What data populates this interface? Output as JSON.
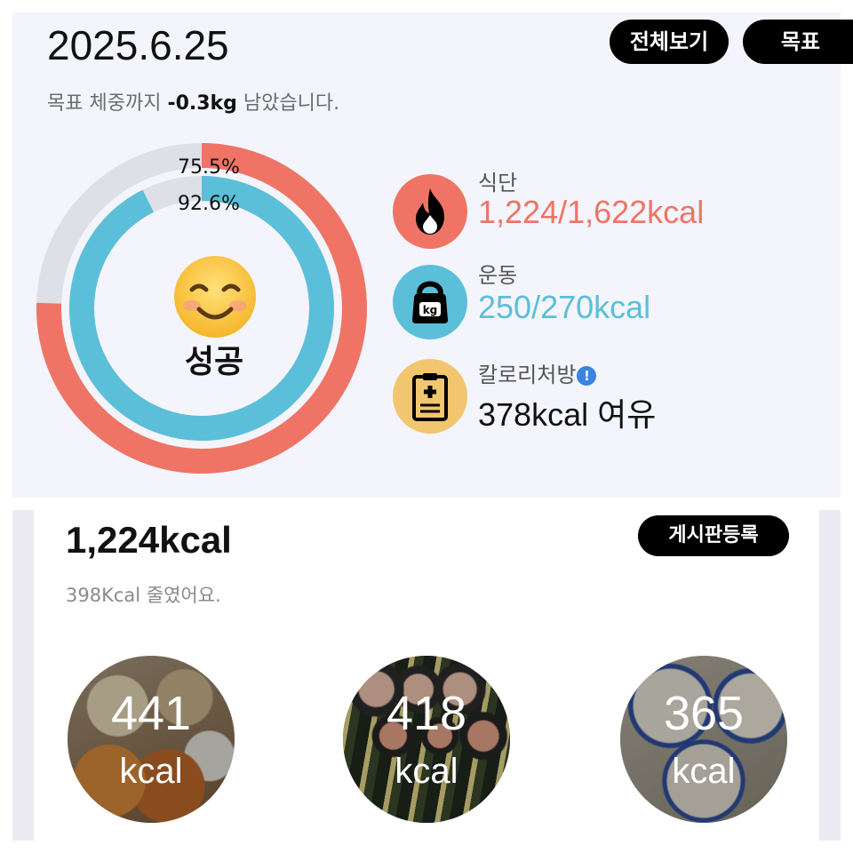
{
  "header": {
    "date": "2025.6.25",
    "view_all_label": "전체보기",
    "goal_label": "목표",
    "goal_text_before": "목표 체중까지 ",
    "goal_weight": "-0.3kg",
    "goal_text_after": " 남았습니다."
  },
  "progress": {
    "outer_percent": "75.5%",
    "inner_percent": "92.6%",
    "outer_fraction": 0.755,
    "inner_fraction": 0.926,
    "result_label": "성공",
    "emoji": "smiling-face-icon",
    "colors": {
      "outer": "#ef7465",
      "inner": "#5bbfd9",
      "track": "#dde0e6"
    }
  },
  "stats": {
    "diet": {
      "label": "식단",
      "value": "1,224/1,622kcal",
      "icon": "fire-icon",
      "color": "#ef7465"
    },
    "exercise": {
      "label": "운동",
      "value": "250/270kcal",
      "icon": "kettlebell-icon",
      "color": "#5bbfd9"
    },
    "prescription": {
      "label": "칼로리처방",
      "value": "378kcal 여유",
      "icon": "clipboard-icon",
      "info_icon": "info-icon",
      "color": "#f2c66e"
    }
  },
  "daily": {
    "total": "1,224kcal",
    "board_button": "게시판등록",
    "note": "398Kcal 줄였어요.",
    "meals": [
      {
        "kcal": "441",
        "unit": "kcal"
      },
      {
        "kcal": "418",
        "unit": "kcal"
      },
      {
        "kcal": "365",
        "unit": "kcal"
      }
    ]
  }
}
